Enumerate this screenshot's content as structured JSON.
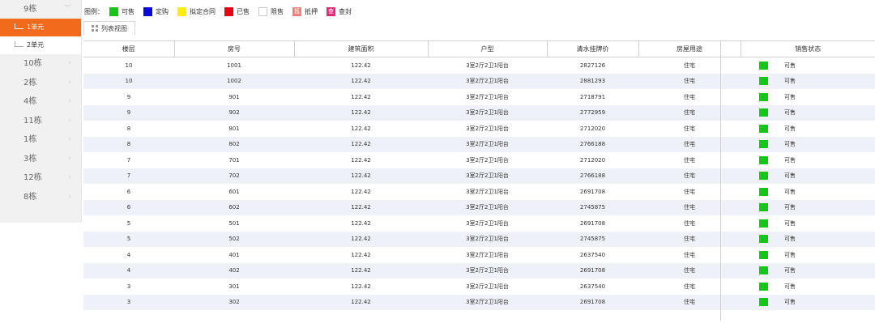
{
  "colors": {
    "accent": "#f26b1d",
    "available": "#16c41a",
    "reserved": "#0a0ad8",
    "contract": "#ffee00",
    "sold": "#e60012",
    "restricted": "#ffffff",
    "mortgage": "#ee7f7f",
    "sealed": "#e3287a"
  },
  "sidebar": {
    "top": {
      "label": "9栋",
      "icon": "chevron-down-icon"
    },
    "sub_items": [
      {
        "label": "1单元",
        "active": true
      },
      {
        "label": "2单元",
        "active": false
      }
    ],
    "buildings": [
      {
        "label": "10栋",
        "icon": "chevron-right-icon"
      },
      {
        "label": "2栋",
        "icon": "chevron-right-icon"
      },
      {
        "label": "4栋",
        "icon": "chevron-right-icon"
      },
      {
        "label": "11栋",
        "icon": "chevron-right-icon"
      },
      {
        "label": "1栋",
        "icon": "chevron-right-icon"
      },
      {
        "label": "3栋",
        "icon": "chevron-right-icon"
      },
      {
        "label": "12栋",
        "icon": "chevron-right-icon"
      },
      {
        "label": "8栋",
        "icon": "chevron-right-icon"
      }
    ]
  },
  "legend": {
    "label": "图例：",
    "items": [
      {
        "label": "可售",
        "color": "#16c41a",
        "glyph": ""
      },
      {
        "label": "定购",
        "color": "#0a0ad8",
        "glyph": ""
      },
      {
        "label": "拟定合同",
        "color": "#ffee00",
        "glyph": ""
      },
      {
        "label": "已售",
        "color": "#e60012",
        "glyph": ""
      },
      {
        "label": "限售",
        "color": "#ffffff",
        "glyph": "",
        "outline": true
      },
      {
        "label": "抵押",
        "color": "#ee7f7f",
        "glyph": "抵"
      },
      {
        "label": "查封",
        "color": "#e3287a",
        "glyph": "查"
      }
    ]
  },
  "tab": {
    "label": "列表视图",
    "icon": "grid-icon"
  },
  "table": {
    "headers": [
      "楼层",
      "房号",
      "建筑面积",
      "户型",
      "清水挂牌价",
      "房屋用途",
      "销售状态"
    ],
    "rows": [
      {
        "floor": "10",
        "room": "1001",
        "area": "122.42",
        "layout": "3室2厅2卫1阳台",
        "price": "2827126",
        "use": "住宅",
        "status": "可售"
      },
      {
        "floor": "10",
        "room": "1002",
        "area": "122.42",
        "layout": "3室2厅2卫1阳台",
        "price": "2881293",
        "use": "住宅",
        "status": "可售"
      },
      {
        "floor": "9",
        "room": "901",
        "area": "122.42",
        "layout": "3室2厅2卫1阳台",
        "price": "2718791",
        "use": "住宅",
        "status": "可售"
      },
      {
        "floor": "9",
        "room": "902",
        "area": "122.42",
        "layout": "3室2厅2卫1阳台",
        "price": "2772959",
        "use": "住宅",
        "status": "可售"
      },
      {
        "floor": "8",
        "room": "801",
        "area": "122.42",
        "layout": "3室2厅2卫1阳台",
        "price": "2712020",
        "use": "住宅",
        "status": "可售"
      },
      {
        "floor": "8",
        "room": "802",
        "area": "122.42",
        "layout": "3室2厅2卫1阳台",
        "price": "2766188",
        "use": "住宅",
        "status": "可售"
      },
      {
        "floor": "7",
        "room": "701",
        "area": "122.42",
        "layout": "3室2厅2卫1阳台",
        "price": "2712020",
        "use": "住宅",
        "status": "可售"
      },
      {
        "floor": "7",
        "room": "702",
        "area": "122.42",
        "layout": "3室2厅2卫1阳台",
        "price": "2766188",
        "use": "住宅",
        "status": "可售"
      },
      {
        "floor": "6",
        "room": "601",
        "area": "122.42",
        "layout": "3室2厅2卫1阳台",
        "price": "2691708",
        "use": "住宅",
        "status": "可售"
      },
      {
        "floor": "6",
        "room": "602",
        "area": "122.42",
        "layout": "3室2厅2卫1阳台",
        "price": "2745875",
        "use": "住宅",
        "status": "可售"
      },
      {
        "floor": "5",
        "room": "501",
        "area": "122.42",
        "layout": "3室2厅2卫1阳台",
        "price": "2691708",
        "use": "住宅",
        "status": "可售"
      },
      {
        "floor": "5",
        "room": "502",
        "area": "122.42",
        "layout": "3室2厅2卫1阳台",
        "price": "2745875",
        "use": "住宅",
        "status": "可售"
      },
      {
        "floor": "4",
        "room": "401",
        "area": "122.42",
        "layout": "3室2厅2卫1阳台",
        "price": "2637540",
        "use": "住宅",
        "status": "可售"
      },
      {
        "floor": "4",
        "room": "402",
        "area": "122.42",
        "layout": "3室2厅2卫1阳台",
        "price": "2691708",
        "use": "住宅",
        "status": "可售"
      },
      {
        "floor": "3",
        "room": "301",
        "area": "122.42",
        "layout": "3室2厅2卫1阳台",
        "price": "2637540",
        "use": "住宅",
        "status": "可售"
      },
      {
        "floor": "3",
        "room": "302",
        "area": "122.42",
        "layout": "3室2厅2卫1阳台",
        "price": "2691708",
        "use": "住宅",
        "status": "可售"
      }
    ]
  }
}
